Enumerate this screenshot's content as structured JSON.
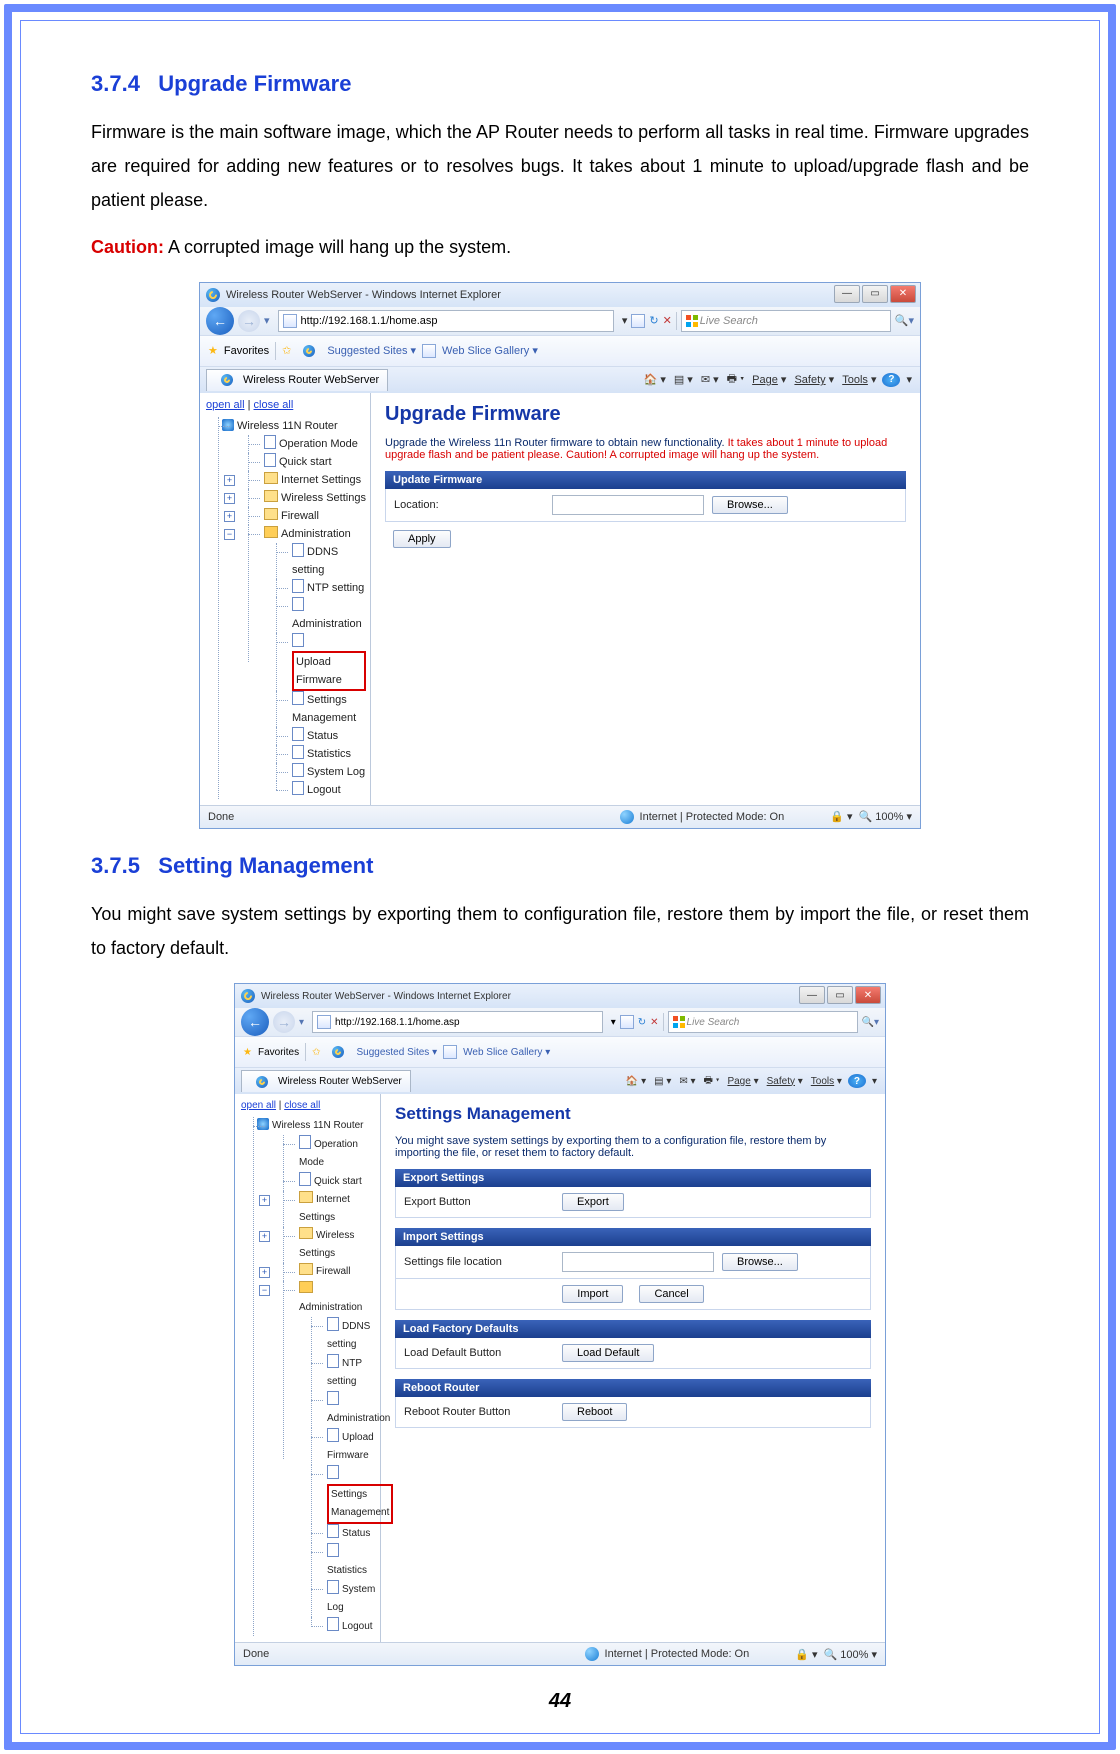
{
  "section1": {
    "number": "3.7.4",
    "title": "Upgrade Firmware",
    "body": "Firmware is the main software image, which the AP Router needs to perform all tasks in real time. Firmware upgrades are required for adding new features or to resolves bugs. It takes about 1 minute to upload/upgrade flash and be patient please.",
    "caution_label": "Caution:",
    "caution_text": " A corrupted image will hang up the system."
  },
  "section2": {
    "number": "3.7.5",
    "title": "Setting Management",
    "body": "You might save system settings by exporting them to configuration file, restore them by import the file, or reset them to factory default."
  },
  "page_number": "44",
  "browser_common": {
    "app_title": "Wireless Router WebServer - Windows Internet Explorer",
    "url": "http://192.168.1.1/home.asp",
    "search_placeholder": "Live Search",
    "favorites_label": "Favorites",
    "suggested_label": "Suggested Sites",
    "webslice_label": "Web Slice Gallery",
    "tab_title": "Wireless Router WebServer",
    "menu_page": "Page",
    "menu_safety": "Safety",
    "menu_tools": "Tools",
    "status_done": "Done",
    "status_internet": "Internet | Protected Mode: On",
    "zoom": "100%",
    "openall": "open all",
    "closeall": "close all"
  },
  "tree": {
    "root": "Wireless 11N Router",
    "op_mode": "Operation Mode",
    "quick_start": "Quick start",
    "internet": "Internet Settings",
    "wireless": "Wireless Settings",
    "firewall": "Firewall",
    "admin": "Administration",
    "ddns": "DDNS setting",
    "ntp": "NTP setting",
    "admin2": "Administration",
    "upload_fw": "Upload Firmware",
    "settings_mgmt": "Settings Management",
    "status": "Status",
    "stats": "Statistics",
    "syslog": "System Log",
    "logout": "Logout"
  },
  "shot1": {
    "page_title": "Upgrade Firmware",
    "desc_black": "Upgrade the Wireless 11n Router firmware to obtain new functionality. ",
    "desc_red": "It takes about 1 minute to upload   upgrade flash and be patient please. Caution! A corrupted image will hang up the system.",
    "section": "Update Firmware",
    "location_label": "Location:",
    "browse": "Browse...",
    "apply": "Apply"
  },
  "shot2": {
    "page_title": "Settings Management",
    "desc": "You might save system settings by exporting them to a configuration file, restore them by importing the file, or reset them to factory default.",
    "export_hdr": "Export Settings",
    "export_lbl": "Export Button",
    "export_btn": "Export",
    "import_hdr": "Import Settings",
    "import_lbl": "Settings file location",
    "import_btn": "Import",
    "cancel_btn": "Cancel",
    "browse": "Browse...",
    "factory_hdr": "Load Factory Defaults",
    "factory_lbl": "Load Default Button",
    "factory_btn": "Load Default",
    "reboot_hdr": "Reboot Router",
    "reboot_lbl": "Reboot Router Button",
    "reboot_btn": "Reboot"
  }
}
